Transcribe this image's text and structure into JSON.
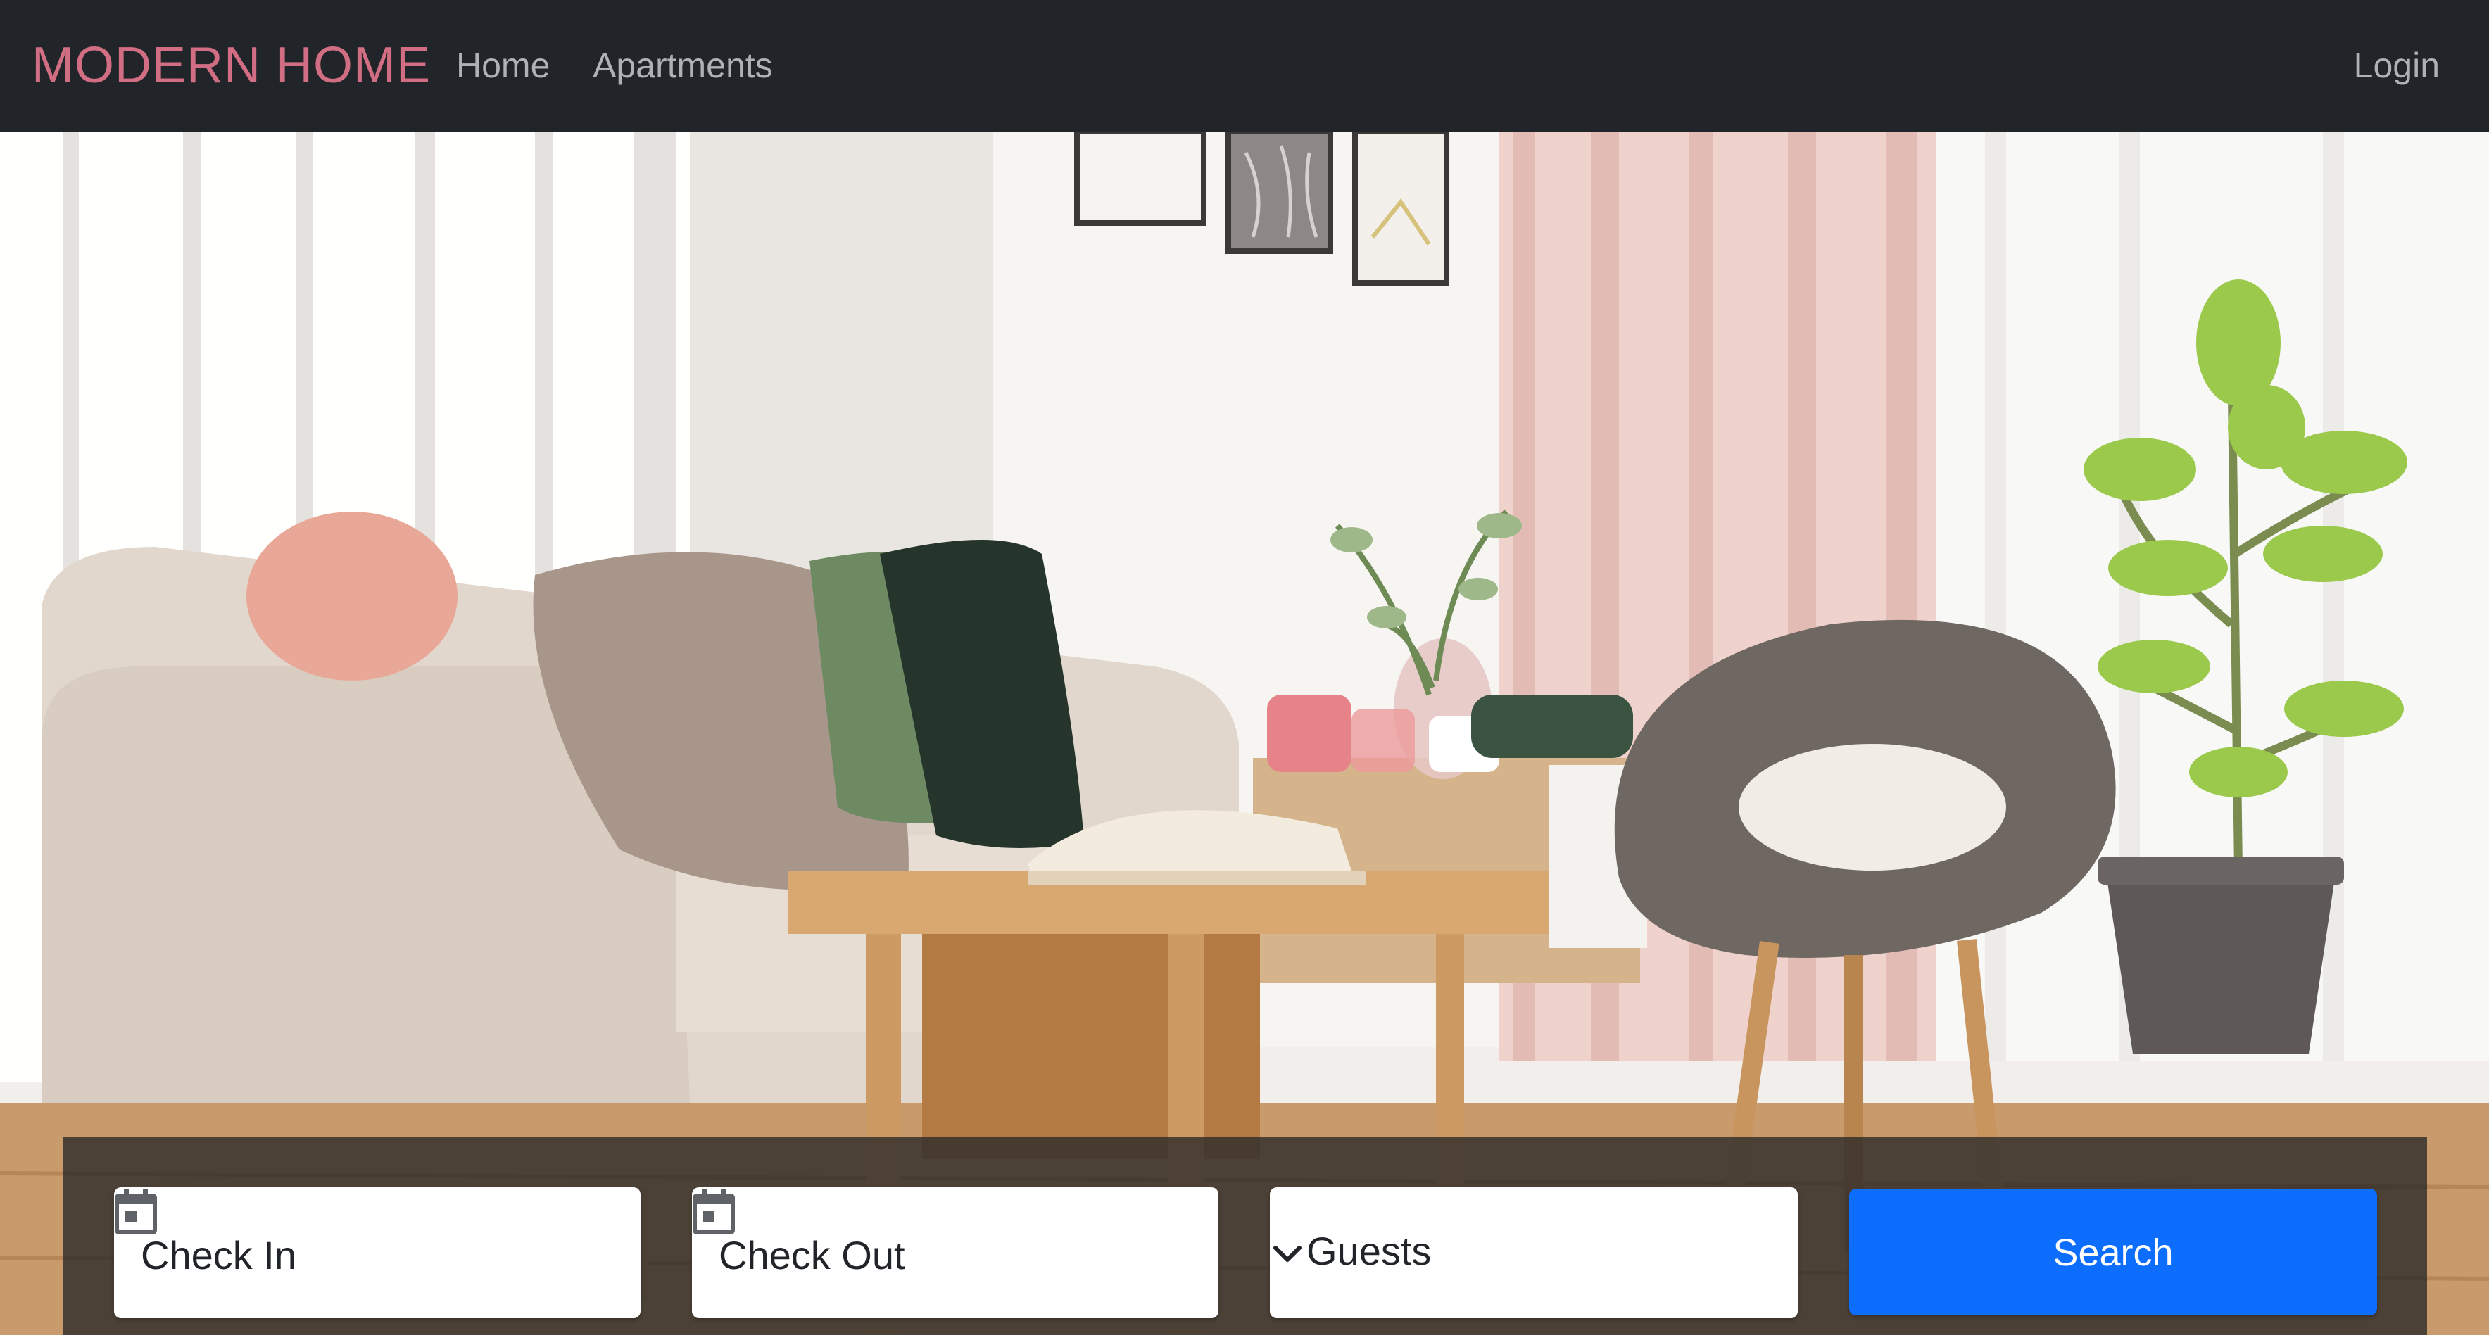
{
  "navbar": {
    "brand": "MODERN HOME",
    "links": [
      {
        "label": "Home"
      },
      {
        "label": "Apartments"
      }
    ],
    "login_label": "Login"
  },
  "hero": {
    "image_description_icon": "living-room-photo"
  },
  "search": {
    "check_in_placeholder": "Check In",
    "check_out_placeholder": "Check Out",
    "guests_placeholder": "Guests",
    "button_label": "Search"
  },
  "colors": {
    "navbar_bg": "#212529",
    "brand": "#d16e84",
    "nav_link": "#aeb2b7",
    "search_button": "#0d6efd",
    "panel": "rgba(40,40,40,0.78)"
  },
  "icons": {
    "check_in": "calendar-icon",
    "check_out": "calendar-icon",
    "guests": "chevron-down-icon"
  }
}
